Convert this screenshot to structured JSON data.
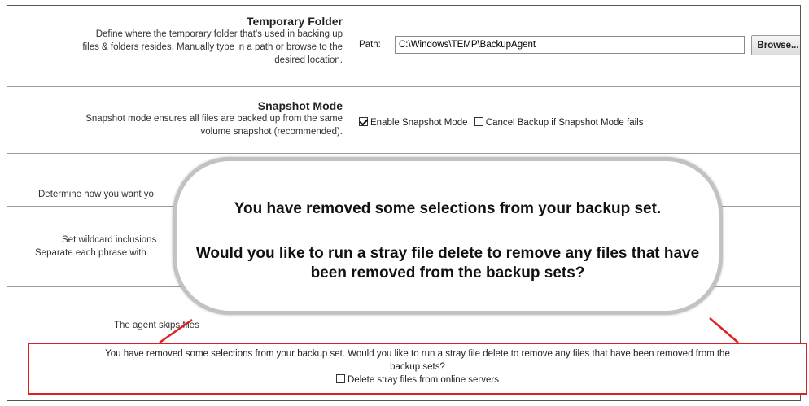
{
  "temporary_folder": {
    "title": "Temporary Folder",
    "description_lines": [
      "Define where the temporary folder that's used in backing up",
      "files & folders resides. Manually type in a path or browse to the",
      "desired location."
    ],
    "path_label": "Path:",
    "path_value": "C:\\Windows\\TEMP\\BackupAgent",
    "browse_button": "Browse..."
  },
  "snapshot_mode": {
    "title": "Snapshot Mode",
    "description_lines": [
      "Snapshot mode ensures all files are backed up from the same",
      "volume snapshot (recommended)."
    ],
    "enable_label": "Enable Snapshot Mode",
    "enable_checked": true,
    "cancel_label": "Cancel Backup if Snapshot Mode fails",
    "cancel_checked": false
  },
  "row3": {
    "description": "Determine how you want yo"
  },
  "row4": {
    "description_lines": [
      "Set wildcard inclusions",
      "Separate each phrase with"
    ]
  },
  "row5": {
    "description": "The agent skips files"
  },
  "popup": {
    "line1": "You have removed some selections from your backup set.",
    "line2": "Would you like to run a stray file delete to remove any files that have been removed from the backup sets?"
  },
  "stray_notice": {
    "text_line1": "You have removed some selections from your backup set. Would you like to run a stray file delete to remove any files that have been removed from the",
    "text_line2": "backup sets?",
    "checkbox_label": "Delete stray files from online servers",
    "checkbox_checked": false
  },
  "colors": {
    "callout_border": "#e02020",
    "bubble_border": "#c2c2c2",
    "row_divider": "#9a9a9a"
  }
}
